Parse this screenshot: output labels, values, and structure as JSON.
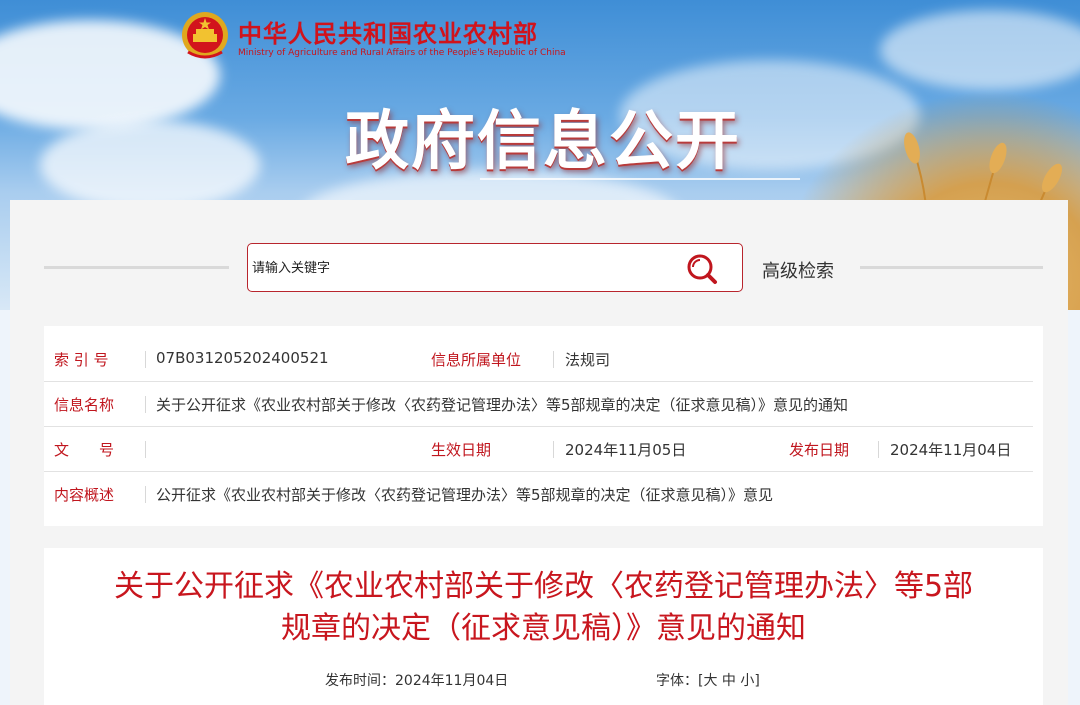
{
  "header": {
    "ministry_cn": "中华人民共和国农业农村部",
    "ministry_en": "Ministry of Agriculture and Rural Affairs of the People's Republic of China",
    "emblem_icon": "national-emblem-icon",
    "hero_title": "政府信息公开"
  },
  "search": {
    "placeholder": "请输入关键字",
    "icon": "search-icon",
    "advanced_label": "高级检索"
  },
  "info": {
    "index_label": "索 引 号",
    "index_value": "07B031205202400521",
    "unit_label": "信息所属单位",
    "unit_value": "法规司",
    "name_label": "信息名称",
    "name_value": "关于公开征求《农业农村部关于修改〈农药登记管理办法〉等5部规章的决定（征求意见稿）》意见的通知",
    "doc_no_label": "文　　号",
    "doc_no_value": "",
    "effective_label": "生效日期",
    "effective_value": "2024年11月05日",
    "publish_label": "发布日期",
    "publish_value": "2024年11月04日",
    "summary_label": "内容概述",
    "summary_value": "公开征求《农业农村部关于修改〈农药登记管理办法〉等5部规章的决定（征求意见稿）》意见"
  },
  "article": {
    "title_line1": "关于公开征求《农业农村部关于修改〈农药登记管理办法〉等5部",
    "title_line2": "规章的决定（征求意见稿）》意见的通知",
    "publish_time_label": "发布时间：",
    "publish_time_value": "2024年11月04日",
    "font_label": "字体：",
    "font_open": "[",
    "font_large": "大",
    "font_medium": "中",
    "font_small": "小",
    "font_close": "]"
  },
  "colors": {
    "accent_red": "#c0161e",
    "banner_blue": "#3f8ed6"
  }
}
